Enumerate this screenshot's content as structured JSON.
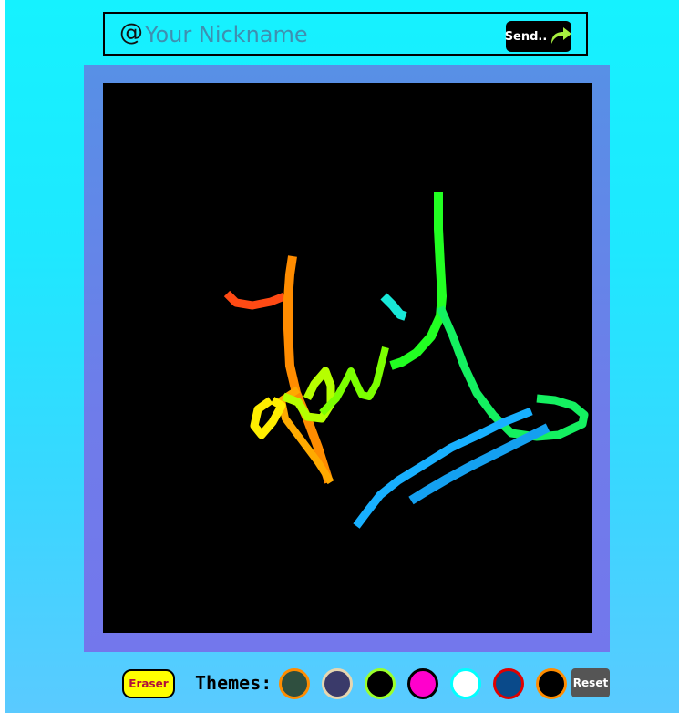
{
  "nickname": {
    "at_symbol": "@",
    "placeholder": "Your Nickname",
    "value": ""
  },
  "send": {
    "label": "Send..",
    "icon": "share-arrow-icon",
    "arrow_color": "#a8f040"
  },
  "canvas": {
    "background": "#000000"
  },
  "toolbar": {
    "eraser_label": "Eraser",
    "themes_label": "Themes:",
    "reset_label": "Reset",
    "themes": [
      {
        "name": "dark-green",
        "fill": "#2f4f3f",
        "ring": "#ff8c00"
      },
      {
        "name": "slate",
        "fill": "#3a3a6a",
        "ring": "#e6d6b0"
      },
      {
        "name": "black-lime",
        "fill": "#000000",
        "ring": "#9aff2a"
      },
      {
        "name": "magenta",
        "fill": "#ff00cc",
        "ring": "#000000"
      },
      {
        "name": "white",
        "fill": "#ffffff",
        "ring": "#00ffff"
      },
      {
        "name": "navy-red",
        "fill": "#0a4a8a",
        "ring": "#e00000"
      },
      {
        "name": "black-orange",
        "fill": "#000000",
        "ring": "#ff8c00"
      }
    ]
  }
}
